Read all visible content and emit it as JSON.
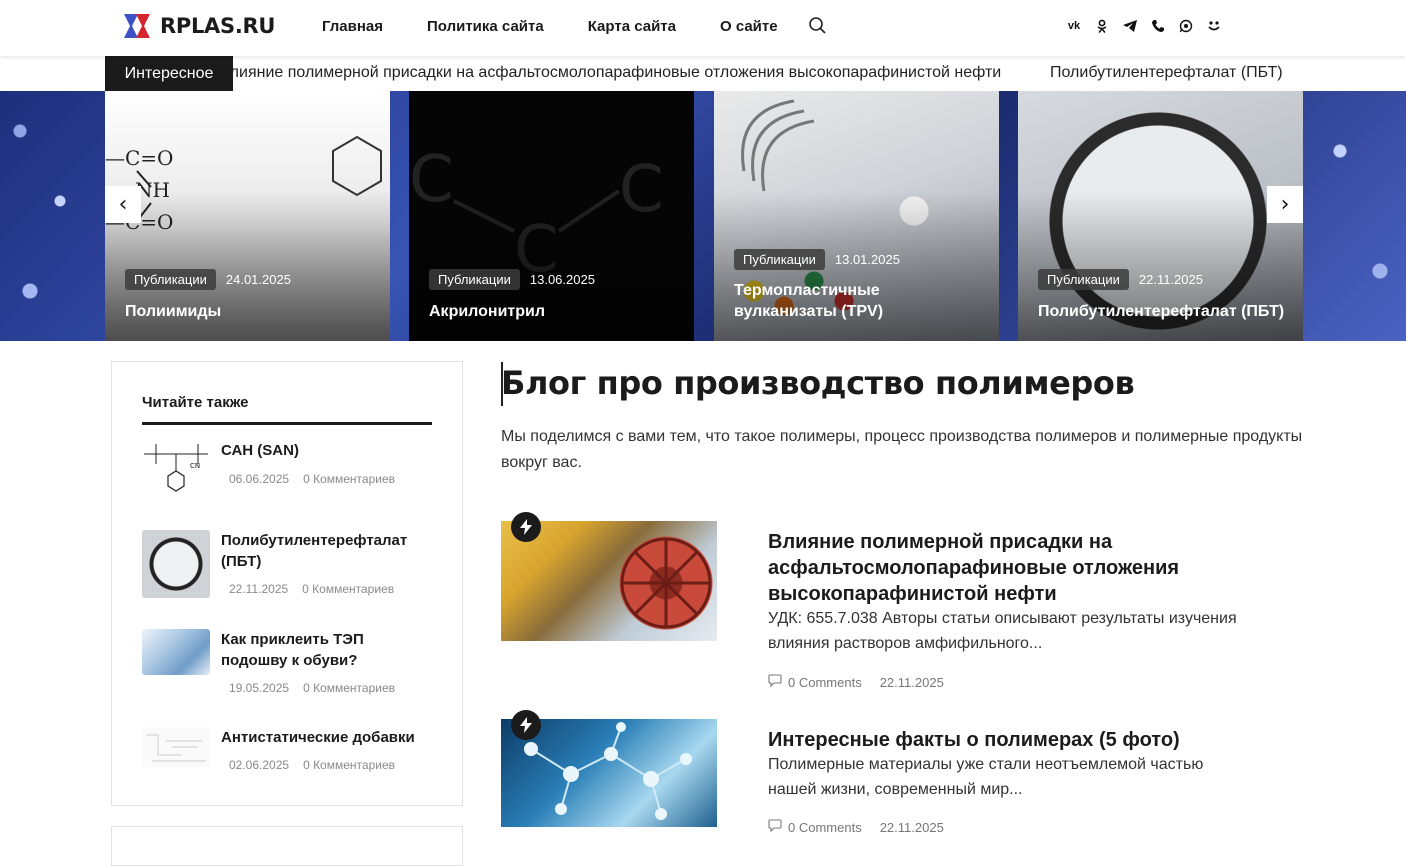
{
  "header": {
    "logo_text": "RPLAS.RU",
    "nav": [
      "Главная",
      "Политика сайта",
      "Карта сайта",
      "О сайте"
    ],
    "socials": [
      "vk-icon",
      "odnoklassniki-icon",
      "telegram-icon",
      "viber-icon",
      "whatsapp-icon",
      "moimir-icon"
    ]
  },
  "ticker": {
    "label": "Интересное",
    "items": [
      "Влияние полимерной присадки на асфальтосмолопарафиновые отложения высокопарафинистой нефти",
      "Полибутилентерефталат (ПБТ)"
    ]
  },
  "slider": {
    "prev": "‹",
    "next": "›",
    "slides": [
      {
        "category": "Публикации",
        "date": "24.01.2025",
        "title": "Полиимиды"
      },
      {
        "category": "Публикации",
        "date": "13.06.2025",
        "title": "Акрилонитрил"
      },
      {
        "category": "Публикации",
        "date": "13.01.2025",
        "title": "Термопластичные вулканизаты (TPV)"
      },
      {
        "category": "Публикации",
        "date": "22.11.2025",
        "title": "Полибутилентерефталат (ПБТ)"
      }
    ]
  },
  "sidebar": {
    "heading": "Читайте также",
    "items": [
      {
        "title": "САН (SAN)",
        "date": "06.06.2025",
        "comments": "0 Комментариев"
      },
      {
        "title": "Полибутилентерефталат (ПБТ)",
        "date": "22.11.2025",
        "comments": "0 Комментариев"
      },
      {
        "title": "Как приклеить ТЭП подошву к обуви?",
        "date": "19.05.2025",
        "comments": "0 Комментариев"
      },
      {
        "title": "Антистатические добавки",
        "date": "02.06.2025",
        "comments": "0 Комментариев"
      }
    ]
  },
  "main": {
    "title": "Блог про производство полимеров",
    "description": "Мы поделимся с вами тем, что такое полимеры, процесс производства полимеров и полимерные продукты вокруг вас.",
    "posts": [
      {
        "title": "Влияние полимерной присадки на асфальтосмолопарафиновые отложения высокопарафинистой нефти",
        "excerpt": "УДК: 655.7.038 Авторы статьи описывают результаты изучения влияния растворов амфифильного...",
        "comments": "0 Comments",
        "date": "22.11.2025"
      },
      {
        "title": "Интересные факты о полимерах (5 фото)",
        "excerpt": "Полимерные материалы уже стали неотъемлемой частью нашей жизни, современный мир...",
        "comments": "0 Comments",
        "date": "22.11.2025"
      }
    ]
  }
}
